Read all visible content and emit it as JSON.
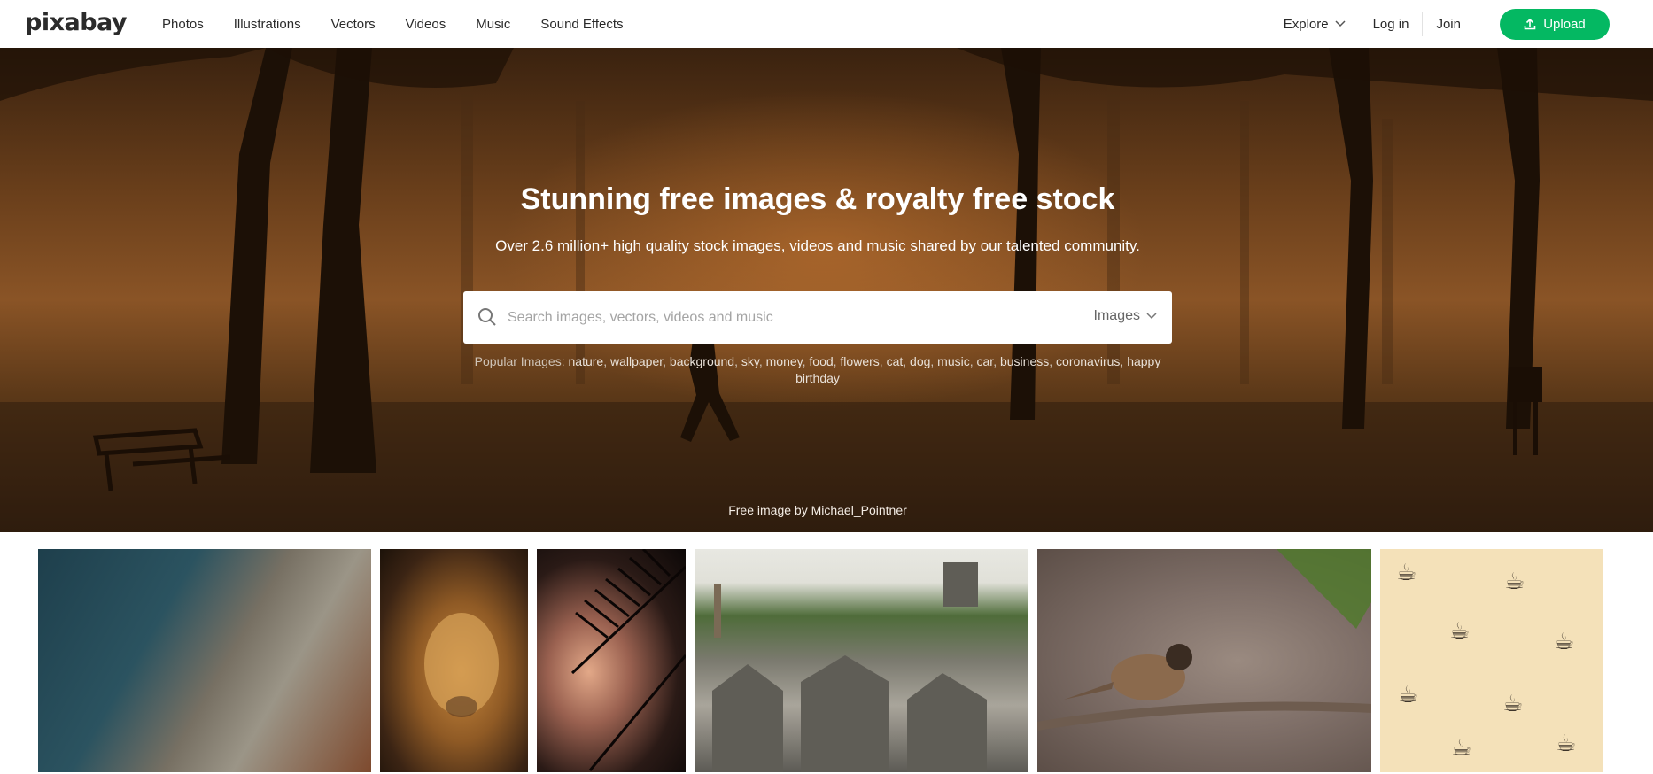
{
  "brand": {
    "logo_text": "pixabay"
  },
  "nav": {
    "links": [
      "Photos",
      "Illustrations",
      "Vectors",
      "Videos",
      "Music",
      "Sound Effects"
    ],
    "explore_label": "Explore",
    "login_label": "Log in",
    "join_label": "Join",
    "upload_label": "Upload"
  },
  "hero": {
    "title": "Stunning free images & royalty free stock",
    "subtitle": "Over 2.6 million+ high quality stock images, videos and music shared by our talented community.",
    "search_placeholder": "Search images, vectors, videos and music",
    "search_type": "Images",
    "popular_label": "Popular Images:",
    "popular_tags": [
      "nature",
      "wallpaper",
      "background",
      "sky",
      "money",
      "food",
      "flowers",
      "cat",
      "dog",
      "music",
      "car",
      "business",
      "coronavirus",
      "happy birthday"
    ],
    "credit": "Free image by Michael_Pointner"
  },
  "colors": {
    "accent": "#04b862",
    "hero_tint": "#8a5426"
  },
  "icons": {
    "search": "search-icon",
    "chevron": "chevron-down-icon",
    "upload": "upload-icon"
  }
}
